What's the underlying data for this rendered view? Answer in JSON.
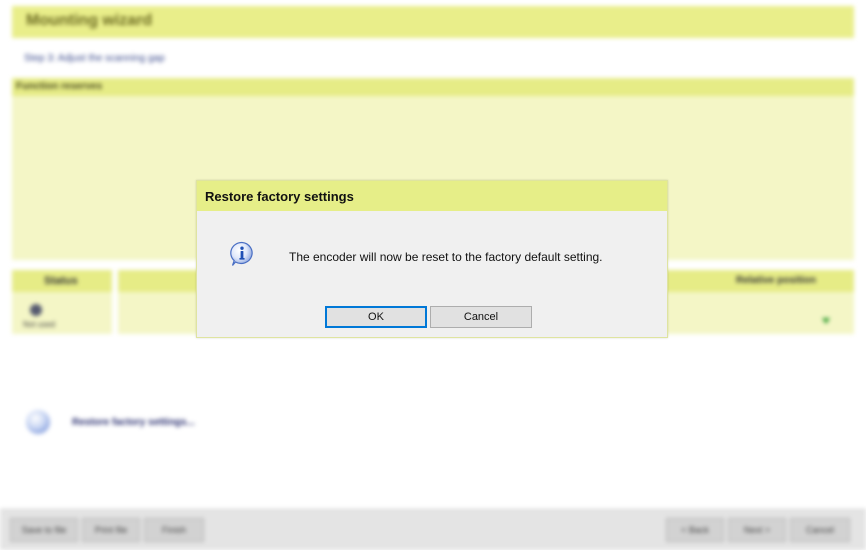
{
  "background": {
    "wizard_title": "Mounting wizard",
    "step_text": "Step 3: Adjust the scanning gap",
    "function_panel_title": "Function reserves",
    "table": {
      "status_header": "Status",
      "relative_position_header": "Relative position",
      "status_value": "Not used"
    },
    "restore_link": "Restore factory settings...",
    "bottom_buttons": [
      "Save to file",
      "Print file",
      "Finish",
      "< Back",
      "Next >",
      "Cancel"
    ]
  },
  "dialog": {
    "title": "Restore factory settings",
    "icon": "info-icon",
    "message": "The encoder will now be reset to the factory default setting.",
    "ok_label": "OK",
    "cancel_label": "Cancel"
  },
  "colors": {
    "accent_bar": "#e6ee88",
    "panel_bg": "#f4f6c6",
    "dialog_bg": "#f0f0f0",
    "focus_blue": "#0078d7"
  }
}
